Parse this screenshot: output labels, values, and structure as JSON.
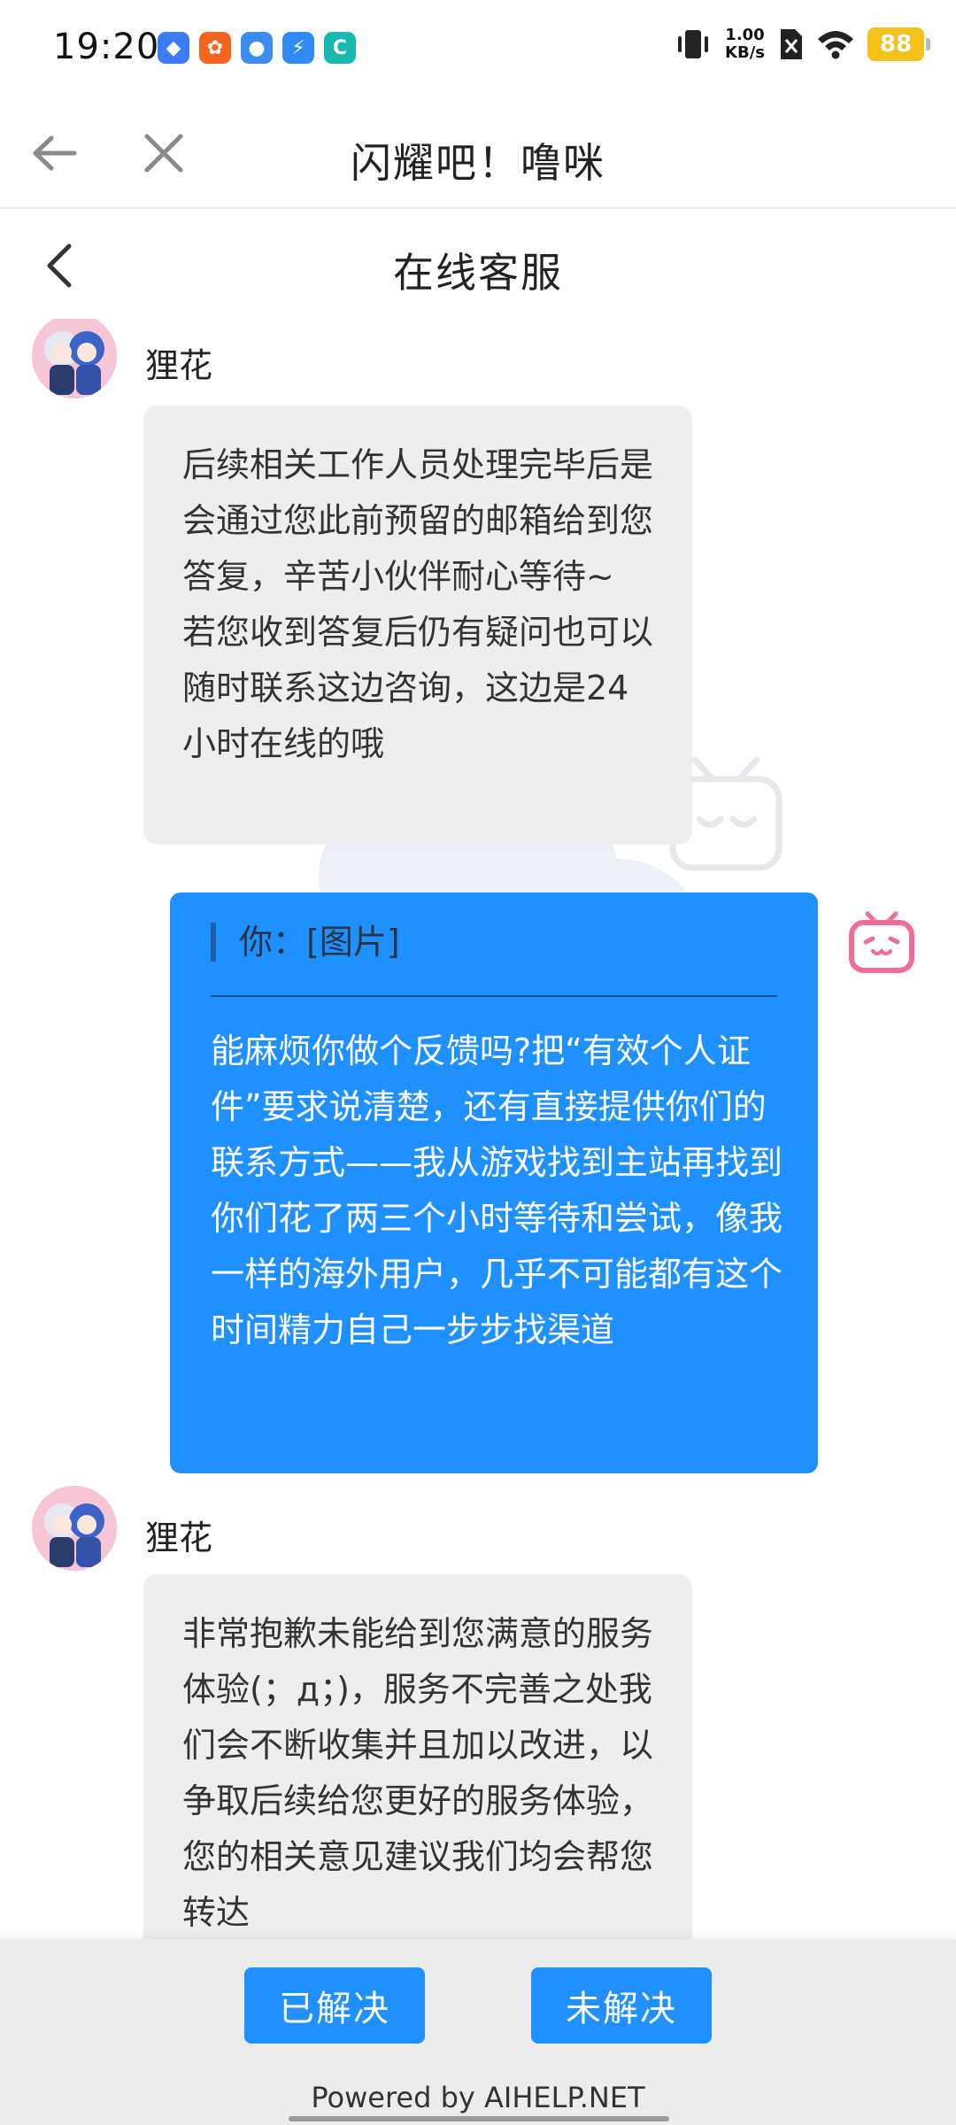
{
  "status_bar": {
    "time": "19:20",
    "net_speed_value": "1.00",
    "net_speed_unit": "KB/s",
    "battery": "88",
    "icons": [
      "app-icon-blue",
      "app-icon-orange",
      "app-icon-baidu",
      "app-icon-flash",
      "app-icon-cyan",
      "vibrate-icon",
      "no-sim-icon",
      "wifi-icon",
      "battery-icon"
    ]
  },
  "topbar": {
    "title": "闪耀吧！噜咪"
  },
  "chat_header": {
    "title": "在线客服"
  },
  "messages": [
    {
      "sender": "狸花",
      "text": "后续相关工作人员处理完毕后是会通过您此前预留的邮箱给到您答复，辛苦小伙伴耐心等待~ 若您收到答复后仍有疑问也可以随时联系这边咨询，这边是24小时在线的哦"
    },
    {
      "quote": "你：[图片]",
      "text": "能麻烦你做个反馈吗?把“有效个人证件”要求说清楚，还有直接提供你们的联系方式——我从游戏找到主站再找到你们花了两三个小时等待和尝试，像我一样的海外用户，几乎不可能都有这个时间精力自己一步步找渠道"
    },
    {
      "sender": "狸花",
      "text": "非常抱歉未能给到您满意的服务体验(；д；)，服务不完善之处我们会不断收集并且加以改进，以争取后续给您更好的服务体验，您的相关意见建议我们均会帮您转达"
    }
  ],
  "bottom": {
    "resolved_label": "已解决",
    "unresolved_label": "未解决",
    "powered_by": "Powered by AIHELP.NET"
  },
  "colors": {
    "accent": "#1e90ff",
    "incoming_bubble": "#eeeeee",
    "battery": "#f3c21b",
    "bilibili_pink": "#f06a9a"
  }
}
